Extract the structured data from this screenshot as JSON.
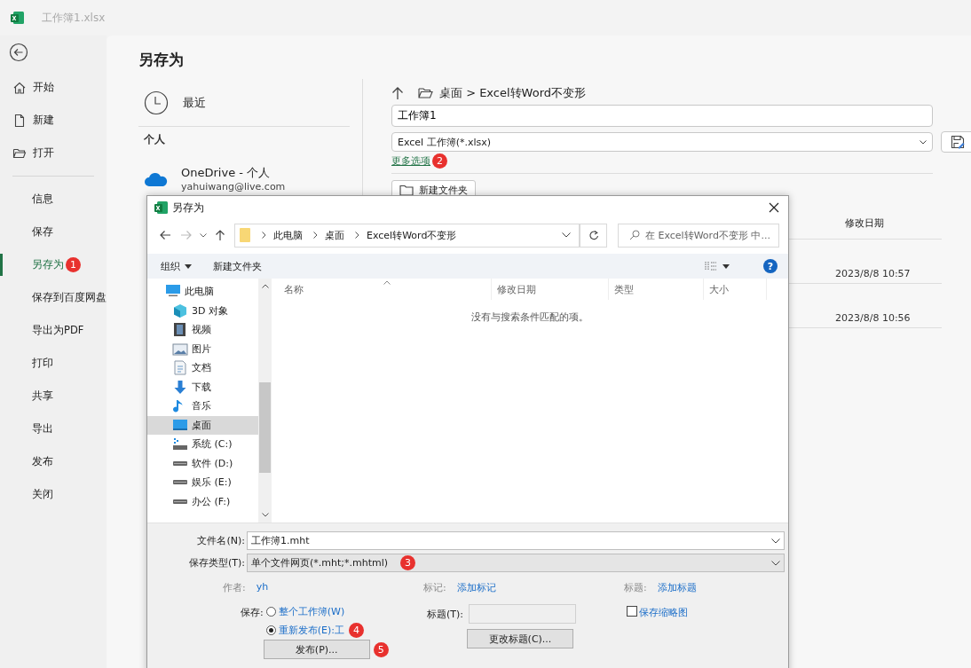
{
  "titlebar": {
    "filename": "工作簿1.xlsx"
  },
  "nav": {
    "top": [
      {
        "label": "开始",
        "kind": "home"
      },
      {
        "label": "新建",
        "kind": "new"
      },
      {
        "label": "打开",
        "kind": "open"
      }
    ],
    "items": [
      {
        "label": "信息",
        "selected": false
      },
      {
        "label": "保存",
        "selected": false
      },
      {
        "label": "另存为",
        "selected": true,
        "badge": "1"
      },
      {
        "label": "保存到百度网盘",
        "selected": false
      },
      {
        "label": "导出为PDF",
        "selected": false
      },
      {
        "label": "打印",
        "selected": false
      },
      {
        "label": "共享",
        "selected": false
      },
      {
        "label": "导出",
        "selected": false
      },
      {
        "label": "发布",
        "selected": false
      },
      {
        "label": "关闭",
        "selected": false
      }
    ]
  },
  "page": {
    "title": "另存为"
  },
  "locations": {
    "recent": "最近",
    "section": "个人",
    "onedrive": {
      "name": "OneDrive - 个人",
      "account": "yahuiwang@live.com"
    }
  },
  "save_pane": {
    "path": "桌面 > Excel转Word不变形",
    "filename": "工作簿1",
    "file_type": "Excel 工作簿(*.xlsx)",
    "more_options": {
      "label": "更多选项",
      "badge": "2"
    },
    "new_folder": "新建文件夹",
    "files": {
      "column": "修改日期",
      "rows": [
        "2023/8/8 10:57",
        "2023/8/8 10:56"
      ]
    }
  },
  "dialog": {
    "title": "另存为",
    "breadcrumbs": [
      "此电脑",
      "桌面",
      "Excel转Word不变形"
    ],
    "search": {
      "placeholder": "在 Excel转Word不变形 中..."
    },
    "toolbar": {
      "organize": "组织",
      "new_folder": "新建文件夹",
      "help": "?"
    },
    "tree": [
      {
        "label": "此电脑",
        "kind": "pc",
        "selected": false,
        "children": [
          {
            "label": "3D 对象",
            "kind": "cube",
            "selected": false
          },
          {
            "label": "视频",
            "kind": "video",
            "selected": false
          },
          {
            "label": "图片",
            "kind": "picture",
            "selected": false
          },
          {
            "label": "文档",
            "kind": "doc",
            "selected": false
          },
          {
            "label": "下载",
            "kind": "download",
            "selected": false
          },
          {
            "label": "音乐",
            "kind": "music",
            "selected": false
          },
          {
            "label": "桌面",
            "kind": "desktop",
            "selected": true
          },
          {
            "label": "系统 (C:)",
            "kind": "system-drive",
            "selected": false
          },
          {
            "label": "软件 (D:)",
            "kind": "drive",
            "selected": false
          },
          {
            "label": "娱乐 (E:)",
            "kind": "drive",
            "selected": false
          },
          {
            "label": "办公 (F:)",
            "kind": "drive",
            "selected": false
          }
        ]
      }
    ],
    "columns": [
      "名称",
      "修改日期",
      "类型",
      "大小"
    ],
    "empty_message": "没有与搜索条件匹配的项。",
    "filename": {
      "label": "文件名(N):",
      "value": "工作簿1.mht"
    },
    "file_type": {
      "label": "保存类型(T):",
      "value": "单个文件网页(*.mht;*.mhtml)",
      "badge": "3"
    },
    "meta": [
      {
        "label": "作者:",
        "value": "yh"
      },
      {
        "label": "标记:",
        "value": "添加标记"
      },
      {
        "label": "标题:",
        "value": "添加标题"
      }
    ],
    "save_label": "保存:",
    "save_options": [
      {
        "label": "整个工作簿(W)",
        "selected": false
      },
      {
        "label": "重新发布(E):工",
        "selected": true,
        "badge": "4"
      }
    ],
    "publish": {
      "label": "发布(P)...",
      "badge": "5"
    },
    "title_field": {
      "label": "标题(T):"
    },
    "change_title": "更改标题(C)...",
    "thumbnail": {
      "label": "保存缩略图",
      "checked": false
    }
  }
}
